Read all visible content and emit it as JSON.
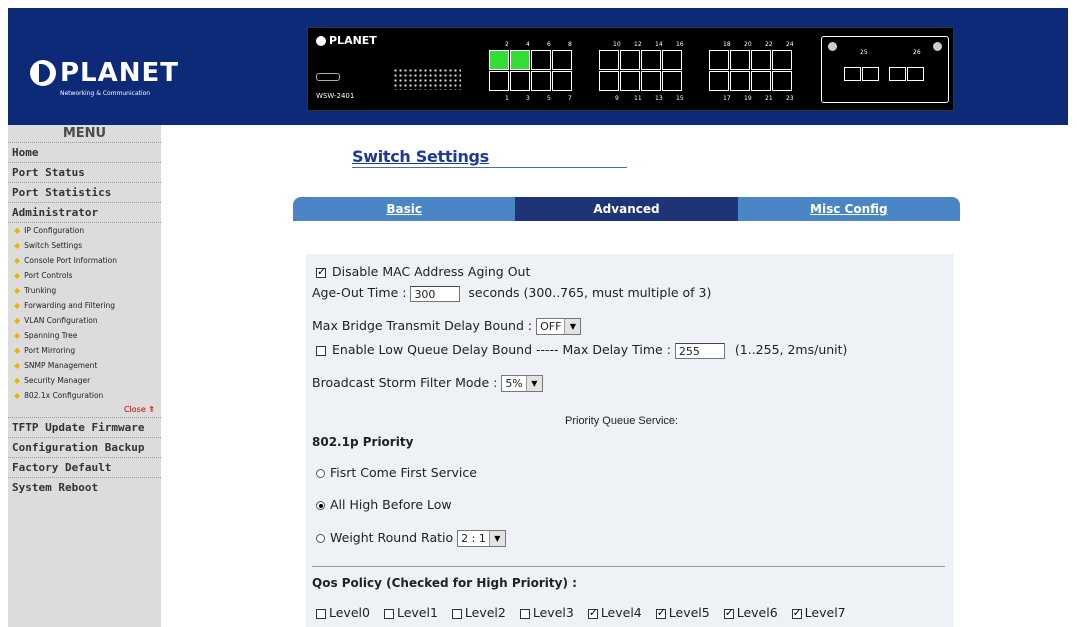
{
  "header": {
    "brand": "PLANET",
    "brand_sub": "Networking & Communication",
    "panel_brand": "PLANET",
    "panel_model": "WSW-2401",
    "top_port_labels": [
      "2",
      "4",
      "6",
      "8",
      "10",
      "12",
      "14",
      "16",
      "18",
      "20",
      "22",
      "24"
    ],
    "bottom_port_labels": [
      "1",
      "3",
      "5",
      "7",
      "9",
      "11",
      "13",
      "15",
      "17",
      "19",
      "21",
      "23"
    ],
    "fiber_labels": [
      "25",
      "26"
    ],
    "active_ports": [
      2,
      4
    ]
  },
  "sidebar": {
    "title": "MENU",
    "items": [
      {
        "label": "Home"
      },
      {
        "label": "Port Status"
      },
      {
        "label": "Port Statistics"
      },
      {
        "label": "Administrator"
      }
    ],
    "sub_items": [
      {
        "label": "IP Configuration"
      },
      {
        "label": "Switch Settings"
      },
      {
        "label": "Console Port Information"
      },
      {
        "label": "Port Controls"
      },
      {
        "label": "Trunking"
      },
      {
        "label": "Forwarding and Filtering"
      },
      {
        "label": "VLAN Configuration"
      },
      {
        "label": "Spanning Tree"
      },
      {
        "label": "Port Mirroring"
      },
      {
        "label": "SNMP Management"
      },
      {
        "label": "Security Manager"
      },
      {
        "label": "802.1x Configuration"
      }
    ],
    "close_label": "Close",
    "bottom_items": [
      {
        "label": "TFTP Update Firmware"
      },
      {
        "label": "Configuration Backup"
      },
      {
        "label": "Factory Default"
      },
      {
        "label": "System Reboot"
      }
    ]
  },
  "main": {
    "title": "Switch Settings",
    "tabs": [
      {
        "label": "Basic"
      },
      {
        "label": "Advanced"
      },
      {
        "label": "Misc Config"
      }
    ],
    "disable_mac_aging": {
      "label": "Disable MAC Address Aging Out",
      "checked": true
    },
    "age_out": {
      "label": "Age-Out Time :",
      "value": "300",
      "suffix": "seconds (300..765, must multiple of 3)"
    },
    "max_bridge": {
      "label": "Max Bridge Transmit Delay Bound :",
      "value": "OFF"
    },
    "low_queue": {
      "label": "Enable Low Queue Delay Bound ----- Max Delay Time :",
      "value": "255",
      "suffix": "(1..255, 2ms/unit)",
      "checked": false
    },
    "broadcast": {
      "label": "Broadcast Storm Filter Mode :",
      "value": "5%"
    },
    "priority_queue_label": "Priority Queue Service:",
    "priority_heading": "802.1p Priority",
    "priority_options": [
      {
        "label": "Fisrt Come First Service",
        "checked": false
      },
      {
        "label": "All High Before Low",
        "checked": true
      },
      {
        "label": "Weight Round Ratio",
        "checked": false
      }
    ],
    "weight_ratio_value": "2 : 1",
    "qos_heading": "Qos Policy (Checked for High Priority) :",
    "levels": [
      {
        "label": "Level0",
        "checked": false
      },
      {
        "label": "Level1",
        "checked": false
      },
      {
        "label": "Level2",
        "checked": false
      },
      {
        "label": "Level3",
        "checked": false
      },
      {
        "label": "Level4",
        "checked": true
      },
      {
        "label": "Level5",
        "checked": true
      },
      {
        "label": "Level6",
        "checked": true
      },
      {
        "label": "Level7",
        "checked": true
      }
    ]
  },
  "colors": {
    "header_bg": "#0d2a79",
    "tab_blue": "#4a86c5",
    "tab_active": "#1f3477",
    "title": "#1c3a96",
    "port_active": "#33dd33"
  }
}
